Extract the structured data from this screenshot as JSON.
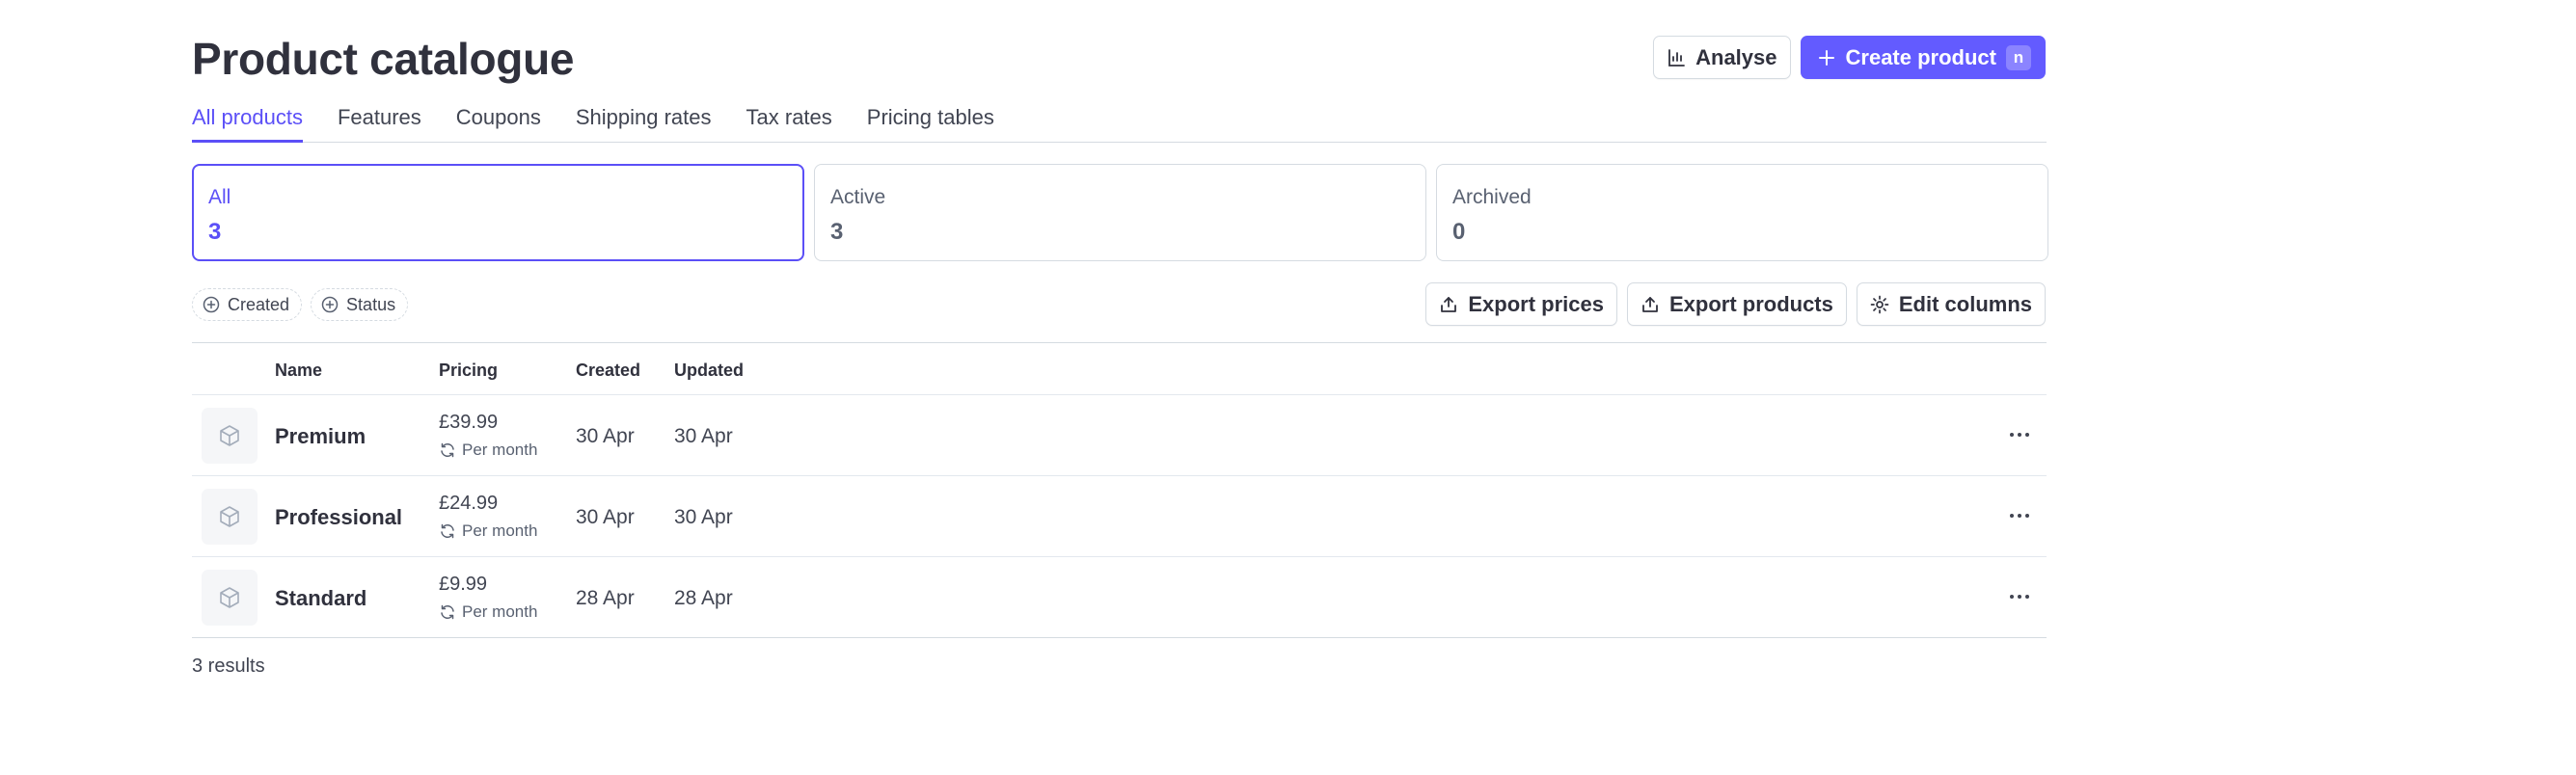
{
  "header": {
    "title": "Product catalogue",
    "analyse_label": "Analyse",
    "create_label": "Create product",
    "create_shortcut": "n"
  },
  "tabs": [
    {
      "label": "All products",
      "active": true
    },
    {
      "label": "Features",
      "active": false
    },
    {
      "label": "Coupons",
      "active": false
    },
    {
      "label": "Shipping rates",
      "active": false
    },
    {
      "label": "Tax rates",
      "active": false
    },
    {
      "label": "Pricing tables",
      "active": false
    }
  ],
  "status_cards": [
    {
      "label": "All",
      "count": "3",
      "active": true
    },
    {
      "label": "Active",
      "count": "3",
      "active": false
    },
    {
      "label": "Archived",
      "count": "0",
      "active": false
    }
  ],
  "filters": [
    {
      "label": "Created",
      "icon": "plus-circle-icon"
    },
    {
      "label": "Status",
      "icon": "plus-circle-icon"
    }
  ],
  "table_actions": {
    "export_prices": "Export prices",
    "export_products": "Export products",
    "edit_columns": "Edit columns"
  },
  "table": {
    "columns": [
      "Name",
      "Pricing",
      "Created",
      "Updated"
    ],
    "rows": [
      {
        "name": "Premium",
        "price": "£39.99",
        "interval": "Per month",
        "created": "30 Apr",
        "updated": "30 Apr"
      },
      {
        "name": "Professional",
        "price": "£24.99",
        "interval": "Per month",
        "created": "30 Apr",
        "updated": "30 Apr"
      },
      {
        "name": "Standard",
        "price": "£9.99",
        "interval": "Per month",
        "created": "28 Apr",
        "updated": "28 Apr"
      }
    ]
  },
  "footer": {
    "results": "3 results"
  },
  "colors": {
    "accent": "#635bff",
    "accent_text": "#5b4ff7",
    "border": "#d5dbe1",
    "text": "#30313d"
  }
}
